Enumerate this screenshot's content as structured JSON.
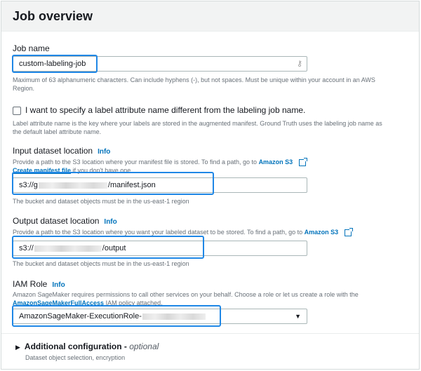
{
  "header": {
    "title": "Job overview"
  },
  "job_name": {
    "label": "Job name",
    "value": "custom-labeling-job",
    "hint_line1": "Maximum of 63 alphanumeric characters. Can include hyphens (-), but not spaces. Must be unique within your account in an AWS",
    "hint_line2": "Region."
  },
  "label_attribute": {
    "checkbox_label": "I want to specify a label attribute name different from the labeling job name.",
    "hint_line1": "Label attribute name is the key where your labels are stored in the augmented manifest. Ground Truth uses the labeling job name as",
    "hint_line2": "the default label attribute name."
  },
  "input_dataset": {
    "label": "Input dataset location",
    "info": "Info",
    "hint_prefix": "Provide a path to the S3 location where your manifest file is stored. To find a path, go to",
    "hint_link": "Amazon S3",
    "create_link": "Create manifest file",
    "create_suffix": " if you don't have one.",
    "value_prefix": "s3://g",
    "value_suffix": "/manifest.json",
    "region_note": "The bucket and dataset objects must be in the us-east-1 region"
  },
  "output_dataset": {
    "label": "Output dataset location",
    "info": "Info",
    "hint_prefix": "Provide a path to the S3 location where you want your labeled dataset to be stored. To find a path, go to",
    "hint_link": "Amazon S3",
    "value_prefix": "s3://",
    "value_suffix": "/output",
    "region_note": "The bucket and dataset objects must be in the us-east-1 region"
  },
  "iam_role": {
    "label": "IAM Role",
    "info": "Info",
    "hint_line1": "Amazon SageMaker requires permissions to call other services on your behalf. Choose a role or let us create a role with the",
    "policy_link": "AmazonSageMakerFullAccess",
    "policy_suffix": " IAM policy attached.",
    "value": "AmazonSageMaker-ExecutionRole-"
  },
  "additional": {
    "title": "Additional configuration",
    "optional": "optional",
    "subtitle": "Dataset object selection, encryption"
  },
  "colors": {
    "highlight": "#1f87e6",
    "link": "#0073bb",
    "header_bg": "#f2f3f3"
  }
}
